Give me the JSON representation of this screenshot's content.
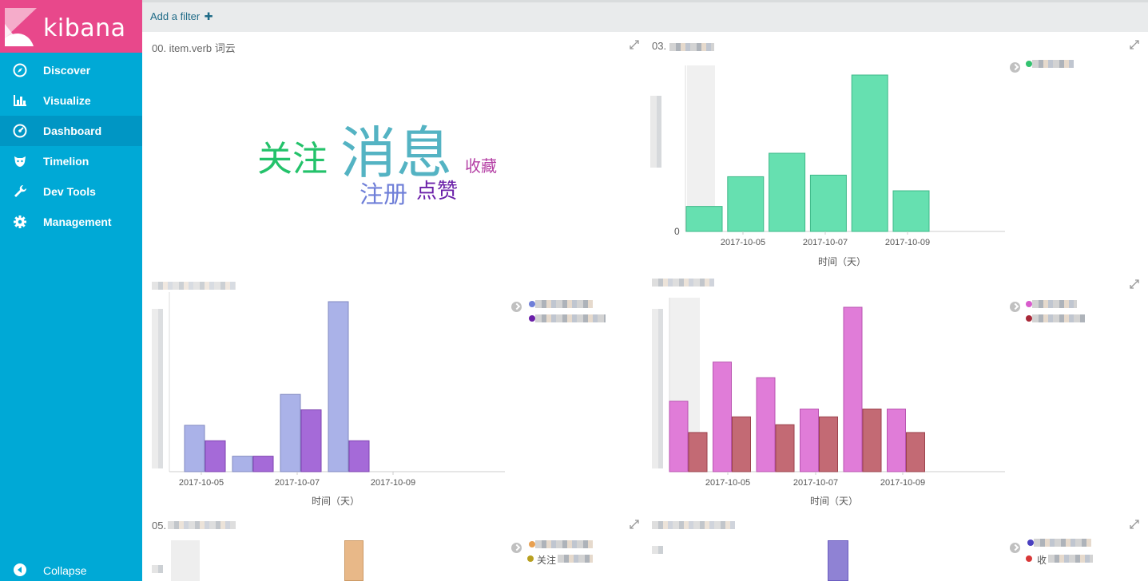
{
  "app": {
    "logo_text": "kibana"
  },
  "sidebar": {
    "items": [
      {
        "label": "Discover",
        "icon": "compass-icon",
        "active": false
      },
      {
        "label": "Visualize",
        "icon": "bar-chart-icon",
        "active": false
      },
      {
        "label": "Dashboard",
        "icon": "dashboard-icon",
        "active": true
      },
      {
        "label": "Timelion",
        "icon": "timelion-icon",
        "active": false
      },
      {
        "label": "Dev Tools",
        "icon": "wrench-icon",
        "active": false
      },
      {
        "label": "Management",
        "icon": "gear-icon",
        "active": false
      }
    ],
    "collapse_label": "Collapse"
  },
  "filterbar": {
    "add_filter_label": "Add a filter",
    "plus": "✚"
  },
  "panels": {
    "wordcloud": {
      "title": "00. item.verb 词云",
      "words": [
        {
          "text": "关注",
          "color": "#23c26a"
        },
        {
          "text": "消息",
          "color": "#54b3c3"
        },
        {
          "text": "收藏",
          "color": "#b43ea4"
        },
        {
          "text": "注册",
          "color": "#6f7fd8"
        },
        {
          "text": "点赞",
          "color": "#6a1fa8"
        }
      ]
    },
    "chart1": {
      "title": "03.",
      "y_zero": "0",
      "xlabel": "时间（天）"
    },
    "chart2": {
      "xlabel": "时间（天）"
    },
    "chart3": {
      "xlabel": "时间（天）"
    },
    "chart4": {
      "title": "05."
    },
    "chart6_legend": {
      "item2": "收"
    },
    "chart5_legend": {
      "item2": "关注"
    }
  },
  "chart_data": [
    {
      "type": "bar",
      "x_ticks": [
        "2017-10-05",
        "2017-10-07",
        "2017-10-09"
      ],
      "xlabel": "时间（天）",
      "ylabel": "",
      "series": [
        {
          "values": [
            16,
            35,
            50,
            36,
            100,
            26
          ],
          "color": "#66e0b0"
        }
      ],
      "ylim": [
        0,
        100
      ]
    },
    {
      "type": "bar",
      "x_ticks": [
        "2017-10-05",
        "2017-10-07",
        "2017-10-09"
      ],
      "xlabel": "时间（天）",
      "ylabel": "",
      "series": [
        {
          "values": [
            3,
            1,
            5,
            11
          ],
          "color": "#aab2e8"
        },
        {
          "values": [
            2,
            1,
            4,
            2
          ],
          "color": "#a56ad8"
        }
      ],
      "ylim": [
        0,
        11
      ]
    },
    {
      "type": "bar",
      "x_ticks": [
        "2017-10-05",
        "2017-10-07",
        "2017-10-09"
      ],
      "xlabel": "时间（天）",
      "ylabel": "",
      "series": [
        {
          "values": [
            9,
            14,
            12,
            8,
            21,
            8
          ],
          "color": "#e07cd8"
        },
        {
          "values": [
            5,
            7,
            6,
            7,
            8,
            5
          ],
          "color": "#c36a74"
        }
      ],
      "ylim": [
        0,
        21
      ]
    }
  ],
  "colors": {
    "sidebar": "#00a9d6",
    "sidebar_active": "#0096c4",
    "logo_bg": "#e8488b",
    "link": "#1f6b87"
  }
}
